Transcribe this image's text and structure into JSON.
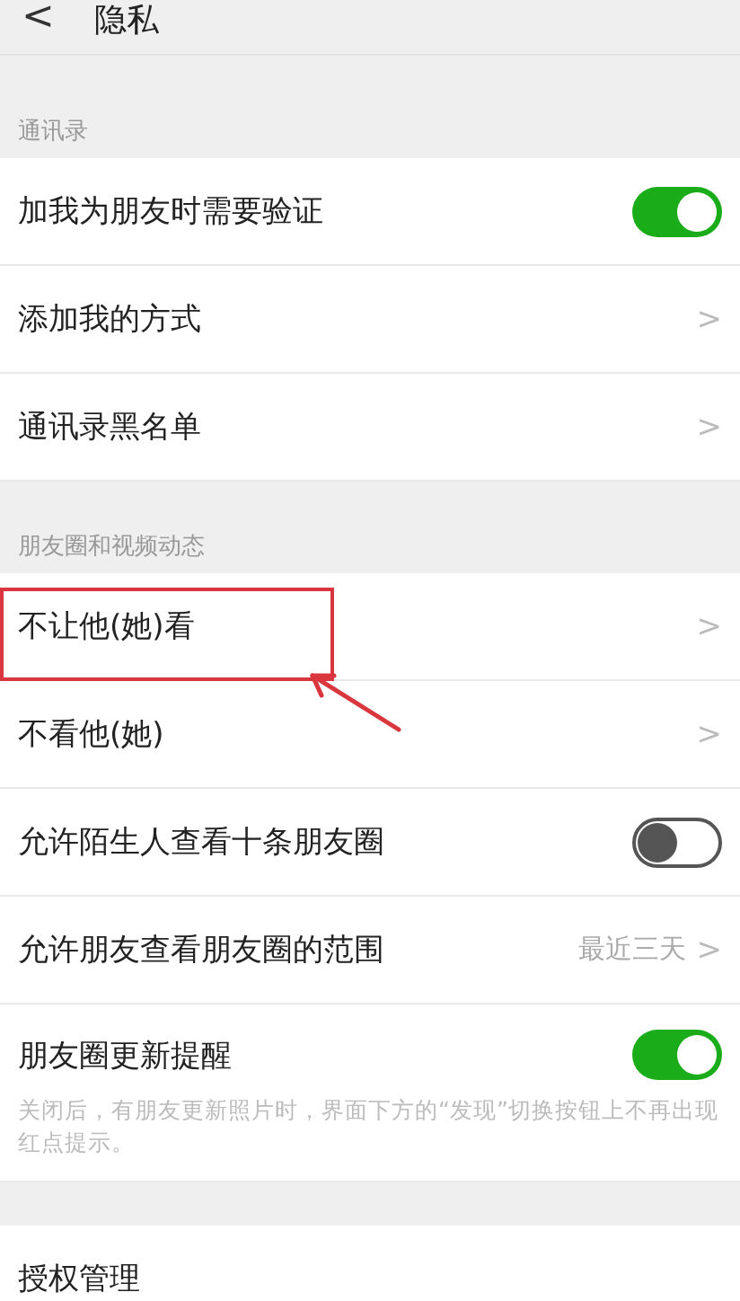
{
  "header": {
    "back": "<",
    "title": "隐私"
  },
  "sections": [
    {
      "label": "通讯录",
      "items": [
        {
          "kind": "toggle",
          "label": "加我为朋友时需要验证",
          "on": true,
          "highlighted": false
        },
        {
          "kind": "link",
          "label": "添加我的方式",
          "chevron": ">",
          "highlighted": false
        },
        {
          "kind": "link",
          "label": "通讯录黑名单",
          "chevron": ">",
          "highlighted": false
        }
      ]
    },
    {
      "label": "朋友圈和视频动态",
      "items": [
        {
          "kind": "link",
          "label": "不让他(她)看",
          "chevron": ">",
          "highlighted": true
        },
        {
          "kind": "link",
          "label": "不看他(她)",
          "chevron": ">",
          "highlighted": false
        },
        {
          "kind": "toggle",
          "label": "允许陌生人查看十条朋友圈",
          "on": false,
          "highlighted": false
        },
        {
          "kind": "value",
          "label": "允许朋友查看朋友圈的范围",
          "value": "最近三天",
          "chevron": ">",
          "highlighted": false
        },
        {
          "kind": "toggle",
          "label": "朋友圈更新提醒",
          "on": true,
          "note": "关闭后，有朋友更新照片时，界面下方的“发现”切换按钮上不再出现红点提示。",
          "highlighted": false
        }
      ]
    },
    {
      "items": [
        {
          "kind": "link",
          "label": "授权管理",
          "highlighted": false
        }
      ]
    }
  ]
}
